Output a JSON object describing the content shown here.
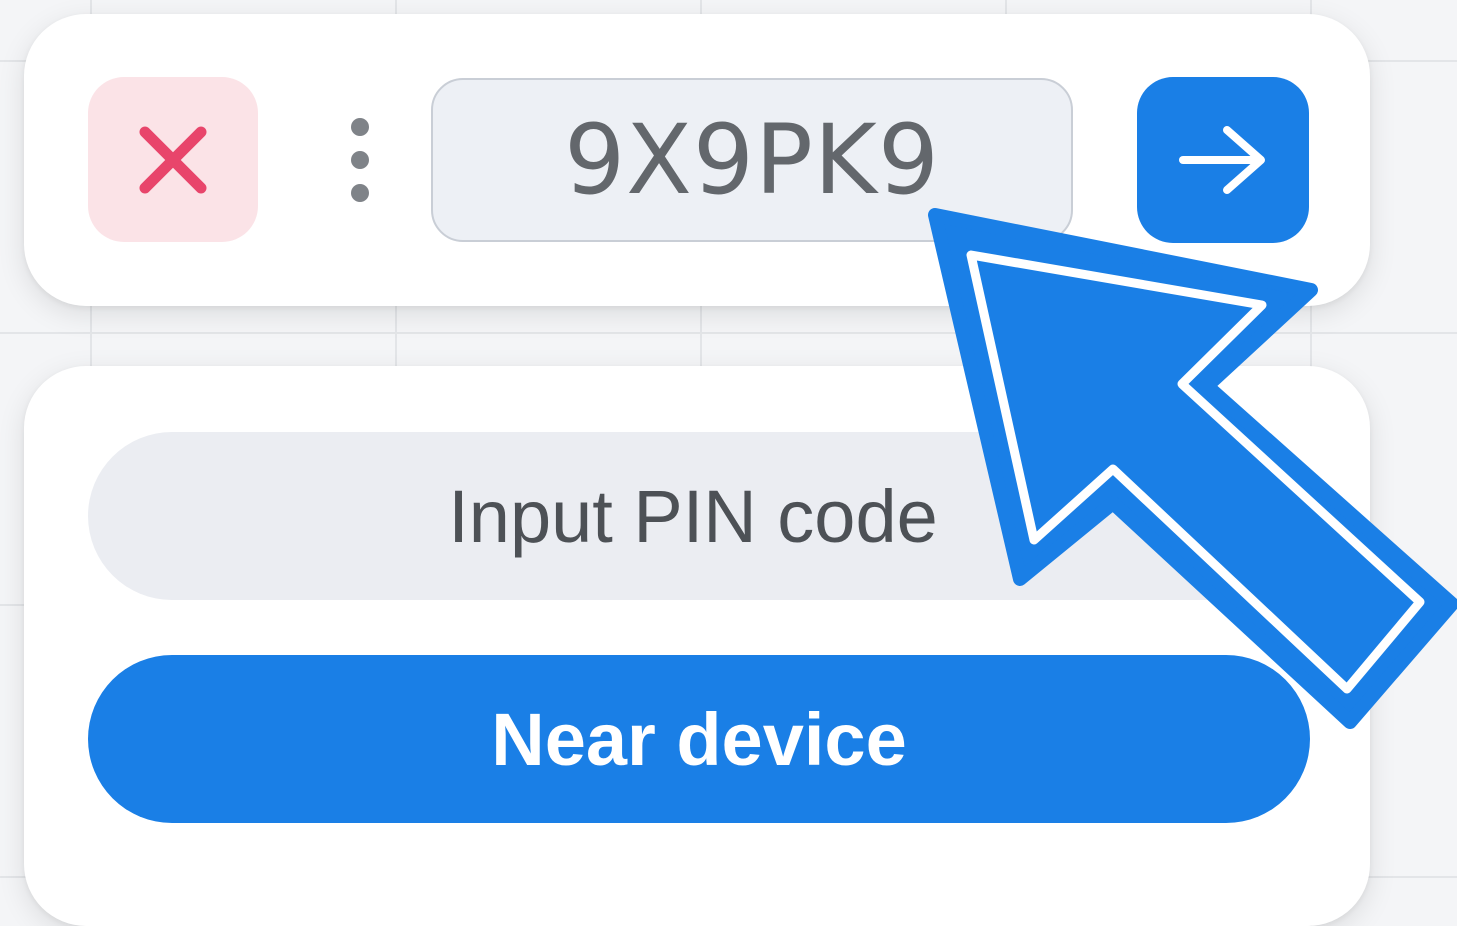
{
  "connect_bar": {
    "close_icon": "close-icon",
    "more_icon": "more-vertical-icon",
    "code_value": "9X9PK9",
    "go_icon": "arrow-right-icon"
  },
  "connect_panel": {
    "pin_placeholder": "Input PIN code",
    "near_device_label": "Near device"
  },
  "overlay": {
    "pointer_icon": "pointer-arrow-icon"
  },
  "colors": {
    "accent": "#1a7fe6",
    "close_bg": "#fbe3e7",
    "close_icon": "#e8456b",
    "field_bg": "#edf0f5"
  }
}
